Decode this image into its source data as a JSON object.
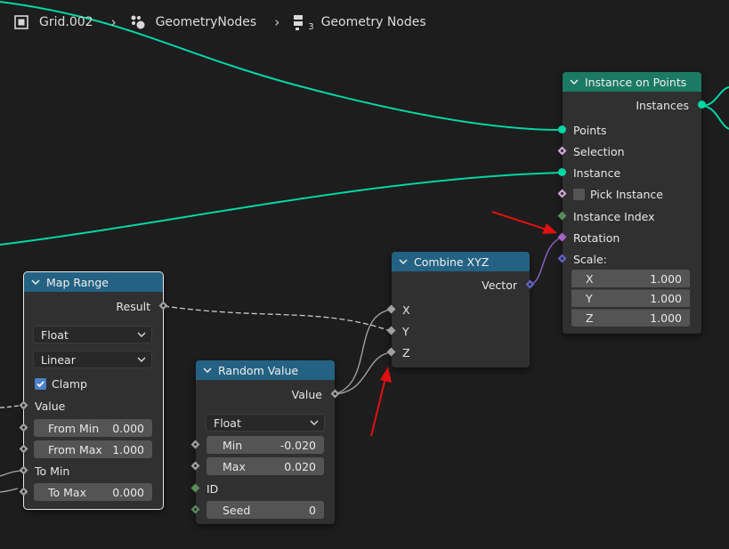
{
  "breadcrumb": {
    "object": "Grid.002",
    "modifier": "GeometryNodes",
    "tree": "Geometry Nodes",
    "tree_users": "3"
  },
  "nodes": {
    "instance_on_points": {
      "title": "Instance on Points",
      "output": "Instances",
      "points": "Points",
      "selection": "Selection",
      "instance": "Instance",
      "pick_instance": "Pick Instance",
      "pick_instance_checked": false,
      "instance_index": "Instance Index",
      "rotation": "Rotation",
      "scale": "Scale:",
      "scale_x_label": "X",
      "scale_x": "1.000",
      "scale_y_label": "Y",
      "scale_y": "1.000",
      "scale_z_label": "Z",
      "scale_z": "1.000"
    },
    "combine_xyz": {
      "title": "Combine XYZ",
      "output": "Vector",
      "x": "X",
      "y": "Y",
      "z": "Z"
    },
    "map_range": {
      "title": "Map Range",
      "output": "Result",
      "data_type": "Float",
      "interpolation": "Linear",
      "clamp": "Clamp",
      "clamp_checked": true,
      "value": "Value",
      "from_min_label": "From Min",
      "from_min": "0.000",
      "from_max_label": "From Max",
      "from_max": "1.000",
      "to_min": "To Min",
      "to_max_label": "To Max",
      "to_max": "0.000"
    },
    "random_value": {
      "title": "Random Value",
      "output": "Value",
      "data_type": "Float",
      "min_label": "Min",
      "min": "-0.020",
      "max_label": "Max",
      "max": "0.020",
      "id": "ID",
      "seed_label": "Seed",
      "seed": "0"
    }
  },
  "colors": {
    "geometry_socket": "#00d6a3",
    "float_socket": "#a1a1a1",
    "vector_socket": "#6363c7",
    "rotation_socket": "#a663c7",
    "int_socket": "#598c5c",
    "bool_socket": "#cca6d6",
    "geometry_header": "#1b7a63",
    "converter_header": "#246283",
    "annotation_arrow": "#e01010"
  }
}
